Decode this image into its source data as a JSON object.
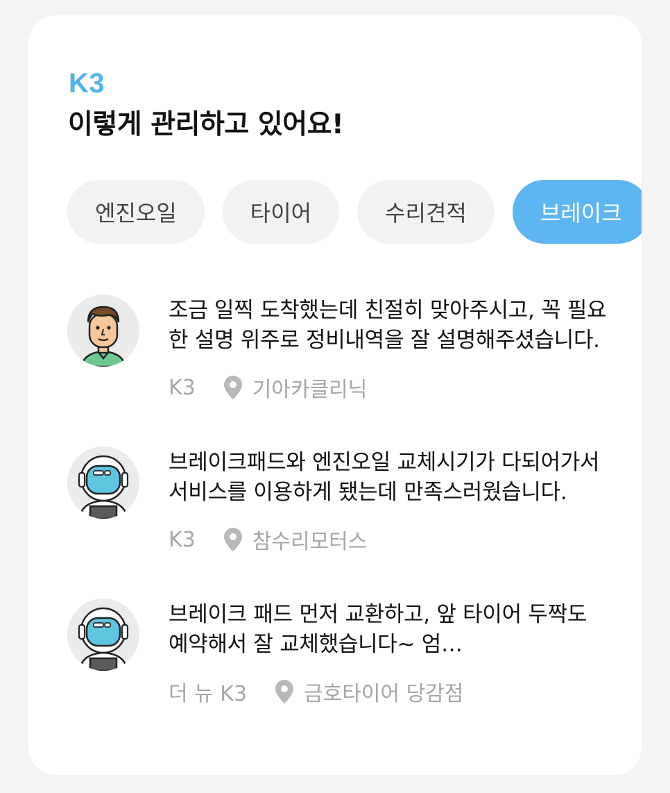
{
  "car_name": "K3",
  "headline": "이렇게 관리하고 있어요!",
  "categories": [
    {
      "label": "엔진오일",
      "active": false
    },
    {
      "label": "타이어",
      "active": false
    },
    {
      "label": "수리견적",
      "active": false
    },
    {
      "label": "브레이크",
      "active": true
    }
  ],
  "reviews": [
    {
      "avatar": "man-avatar-icon",
      "text": "조금 일찍 도착했는데 친절히 맞아주시고, 꼭 필요한 설명 위주로 정비내역을 잘 설명해주셨습니다.",
      "car": "K3",
      "shop": "기아카클리닉"
    },
    {
      "avatar": "astronaut-avatar-icon",
      "text": "브레이크패드와 엔진오일 교체시기가 다되어가서 서비스를 이용하게 됐는데 만족스러웠습니다.",
      "car": "K3",
      "shop": "참수리모터스"
    },
    {
      "avatar": "astronaut-avatar-icon",
      "text": "브레이크 패드 먼저 교환하고, 앞 타이어 두짝도 예약해서 잘 교체했습니다~ 엄…",
      "car": "더 뉴 K3",
      "shop": "금호타이어 당감점"
    }
  ],
  "colors": {
    "accent": "#4fb3ef",
    "chip_active": "#5db6f2",
    "chip_inactive": "#f2f2f2",
    "meta_text": "#a6a6a6"
  }
}
